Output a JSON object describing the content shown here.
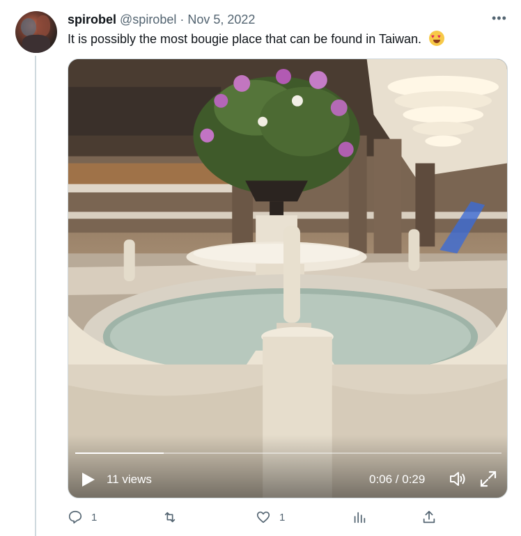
{
  "tweet": {
    "author_name": "spirobel",
    "handle": "@spirobel",
    "separator": "·",
    "date": "Nov 5, 2022",
    "more_label": "•••",
    "text": "It is possibly the most bougie place that can be found in Taiwan.",
    "emoji": "heart-eyes-emoji"
  },
  "video": {
    "views": "11 views",
    "time": "0:06 / 0:29",
    "progress": 0.207,
    "icons": [
      "play-icon",
      "volume-icon",
      "expand-icon"
    ]
  },
  "actions": {
    "reply_count": "1",
    "retweet_count": "",
    "like_count": "1",
    "icons": [
      "reply-icon",
      "retweet-icon",
      "like-icon",
      "views-icon",
      "share-icon"
    ]
  },
  "colors": {
    "text_primary": "#0f1419",
    "text_secondary": "#536471",
    "thread_line": "#cfd9de"
  }
}
